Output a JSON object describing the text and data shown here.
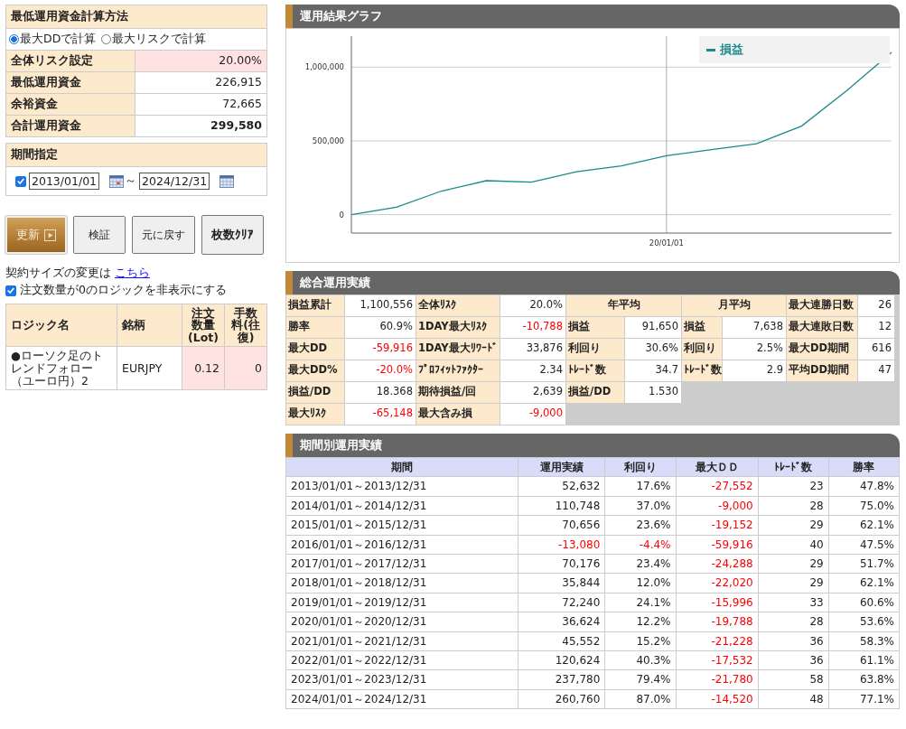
{
  "calc_method": {
    "title": "最低運用資金計算方法",
    "options": [
      {
        "label": "最大DDで計算",
        "selected": true
      },
      {
        "label": "最大リスクで計算",
        "selected": false
      }
    ]
  },
  "funds": [
    {
      "label": "全体リスク設定",
      "value": "20.00%",
      "kind": "input"
    },
    {
      "label": "最低運用資金",
      "value": "226,915",
      "kind": "plain"
    },
    {
      "label": "余裕資金",
      "value": "72,665",
      "kind": "plain"
    },
    {
      "label": "合計運用資金",
      "value": "299,580",
      "kind": "total"
    }
  ],
  "period": {
    "title": "期間指定",
    "enabled": true,
    "from": "2013/01/01",
    "separator": "～",
    "to": "2024/12/31"
  },
  "buttons": [
    {
      "label": "更新",
      "kind": "primary"
    },
    {
      "label": "検証",
      "kind": "normal"
    },
    {
      "label": "元に戻す",
      "kind": "normal"
    },
    {
      "label": "枚数ｸﾘｱ",
      "kind": "bold"
    }
  ],
  "contract_note": {
    "text": "契約サイズの変更は",
    "link": "こちら"
  },
  "hide_zero": {
    "label": "注文数量が0のロジックを非表示にする",
    "checked": true
  },
  "logic_table": {
    "columns": [
      "ロジック名",
      "銘柄",
      "注文数量(Lot)",
      "手数料(往復)"
    ],
    "rows": [
      {
        "name": "●ローソク足のトレンドフォロー（ユーロ円）2",
        "symbol": "EURJPY",
        "lots": "0.12",
        "fee": "0"
      }
    ]
  },
  "graph": {
    "title": "運用結果グラフ",
    "x_axis_label": "20/01/01",
    "chart_data": {
      "type": "line",
      "grid": true,
      "ylim": [
        -125000,
        1210000
      ],
      "yticks": [
        {
          "value": 0,
          "label": "0"
        },
        {
          "value": 500000,
          "label": "500,000"
        },
        {
          "value": 1000000,
          "label": "1,000,000"
        }
      ],
      "categories": [
        null,
        null,
        null,
        null,
        null,
        null,
        null,
        null,
        null,
        null,
        null,
        null,
        null
      ],
      "series": [
        {
          "name": "損益",
          "color": "#1a8a8a",
          "values": [
            0,
            50000,
            160000,
            230000,
            220000,
            290000,
            330000,
            400000,
            440000,
            480000,
            600000,
            840000,
            1100000
          ]
        }
      ]
    }
  },
  "summary": {
    "title": "総合運用実績",
    "groups": [
      {
        "cells": [
          {
            "label": "損益累計",
            "value": "1,100,556",
            "negative": false
          },
          {
            "label": "勝率",
            "value": "60.9%",
            "negative": false
          },
          {
            "label": "最大DD",
            "value": "-59,916",
            "negative": true
          },
          {
            "label": "最大DD%",
            "value": "-20.0%",
            "negative": true
          },
          {
            "label": "損益/DD",
            "value": "18.368",
            "negative": false
          },
          {
            "label": "最大ﾘｽｸ",
            "value": "-65,148",
            "negative": true
          }
        ]
      },
      {
        "cells": [
          {
            "label": "全体ﾘｽｸ",
            "value": "20.0%",
            "negative": false
          },
          {
            "label": "1DAY最大ﾘｽｸ",
            "value": "-10,788",
            "negative": true
          },
          {
            "label": "1DAY最大ﾘﾜｰﾄﾞ",
            "value": "33,876",
            "negative": false
          },
          {
            "label": "ﾌﾟﾛﾌｨｯﾄﾌｧｸﾀｰ",
            "value": "2.34",
            "negative": false
          },
          {
            "label": "期待損益/回",
            "value": "2,639",
            "negative": false
          },
          {
            "label": "最大含み損",
            "value": "-9,000",
            "negative": true
          }
        ]
      },
      {
        "header": "年平均",
        "cells": [
          {
            "label": "損益",
            "value": "91,650",
            "negative": false
          },
          {
            "label": "利回り",
            "value": "30.6%",
            "negative": false
          },
          {
            "label": "ﾄﾚｰﾄﾞ数",
            "value": "34.7",
            "negative": false
          },
          {
            "label": "損益/DD",
            "value": "1.530",
            "negative": false
          }
        ]
      },
      {
        "header": "月平均",
        "cells": [
          {
            "label": "損益",
            "value": "7,638",
            "negative": false
          },
          {
            "label": "利回り",
            "value": "2.5%",
            "negative": false
          },
          {
            "label": "ﾄﾚｰﾄﾞ数",
            "value": "2.9",
            "negative": false
          }
        ]
      },
      {
        "cells": [
          {
            "label": "最大連勝日数",
            "value": "26",
            "negative": false
          },
          {
            "label": "最大連敗日数",
            "value": "12",
            "negative": false
          },
          {
            "label": "最大DD期間",
            "value": "616",
            "negative": false
          },
          {
            "label": "平均DD期間",
            "value": "47",
            "negative": false
          }
        ]
      }
    ]
  },
  "periods": {
    "title": "期間別運用実績",
    "columns": [
      "期間",
      "運用実績",
      "利回り",
      "最大ＤＤ",
      "ﾄﾚｰﾄﾞ数",
      "勝率"
    ],
    "rows": [
      {
        "cells": [
          {
            "text": "2013/01/01～2013/12/31",
            "negative": false
          },
          {
            "text": "52,632",
            "negative": false
          },
          {
            "text": "17.6%",
            "negative": false
          },
          {
            "text": "-27,552",
            "negative": true
          },
          {
            "text": "23",
            "negative": false
          },
          {
            "text": "47.8%",
            "negative": false
          }
        ]
      },
      {
        "cells": [
          {
            "text": "2014/01/01～2014/12/31",
            "negative": false
          },
          {
            "text": "110,748",
            "negative": false
          },
          {
            "text": "37.0%",
            "negative": false
          },
          {
            "text": "-9,000",
            "negative": true
          },
          {
            "text": "28",
            "negative": false
          },
          {
            "text": "75.0%",
            "negative": false
          }
        ]
      },
      {
        "cells": [
          {
            "text": "2015/01/01～2015/12/31",
            "negative": false
          },
          {
            "text": "70,656",
            "negative": false
          },
          {
            "text": "23.6%",
            "negative": false
          },
          {
            "text": "-19,152",
            "negative": true
          },
          {
            "text": "29",
            "negative": false
          },
          {
            "text": "62.1%",
            "negative": false
          }
        ]
      },
      {
        "cells": [
          {
            "text": "2016/01/01～2016/12/31",
            "negative": false
          },
          {
            "text": "-13,080",
            "negative": true
          },
          {
            "text": "-4.4%",
            "negative": true
          },
          {
            "text": "-59,916",
            "negative": true
          },
          {
            "text": "40",
            "negative": false
          },
          {
            "text": "47.5%",
            "negative": false
          }
        ]
      },
      {
        "cells": [
          {
            "text": "2017/01/01～2017/12/31",
            "negative": false
          },
          {
            "text": "70,176",
            "negative": false
          },
          {
            "text": "23.4%",
            "negative": false
          },
          {
            "text": "-24,288",
            "negative": true
          },
          {
            "text": "29",
            "negative": false
          },
          {
            "text": "51.7%",
            "negative": false
          }
        ]
      },
      {
        "cells": [
          {
            "text": "2018/01/01～2018/12/31",
            "negative": false
          },
          {
            "text": "35,844",
            "negative": false
          },
          {
            "text": "12.0%",
            "negative": false
          },
          {
            "text": "-22,020",
            "negative": true
          },
          {
            "text": "29",
            "negative": false
          },
          {
            "text": "62.1%",
            "negative": false
          }
        ]
      },
      {
        "cells": [
          {
            "text": "2019/01/01～2019/12/31",
            "negative": false
          },
          {
            "text": "72,240",
            "negative": false
          },
          {
            "text": "24.1%",
            "negative": false
          },
          {
            "text": "-15,996",
            "negative": true
          },
          {
            "text": "33",
            "negative": false
          },
          {
            "text": "60.6%",
            "negative": false
          }
        ]
      },
      {
        "cells": [
          {
            "text": "2020/01/01～2020/12/31",
            "negative": false
          },
          {
            "text": "36,624",
            "negative": false
          },
          {
            "text": "12.2%",
            "negative": false
          },
          {
            "text": "-19,788",
            "negative": true
          },
          {
            "text": "28",
            "negative": false
          },
          {
            "text": "53.6%",
            "negative": false
          }
        ]
      },
      {
        "cells": [
          {
            "text": "2021/01/01～2021/12/31",
            "negative": false
          },
          {
            "text": "45,552",
            "negative": false
          },
          {
            "text": "15.2%",
            "negative": false
          },
          {
            "text": "-21,228",
            "negative": true
          },
          {
            "text": "36",
            "negative": false
          },
          {
            "text": "58.3%",
            "negative": false
          }
        ]
      },
      {
        "cells": [
          {
            "text": "2022/01/01～2022/12/31",
            "negative": false
          },
          {
            "text": "120,624",
            "negative": false
          },
          {
            "text": "40.3%",
            "negative": false
          },
          {
            "text": "-17,532",
            "negative": true
          },
          {
            "text": "36",
            "negative": false
          },
          {
            "text": "61.1%",
            "negative": false
          }
        ]
      },
      {
        "cells": [
          {
            "text": "2023/01/01～2023/12/31",
            "negative": false
          },
          {
            "text": "237,780",
            "negative": false
          },
          {
            "text": "79.4%",
            "negative": false
          },
          {
            "text": "-21,780",
            "negative": true
          },
          {
            "text": "58",
            "negative": false
          },
          {
            "text": "63.8%",
            "negative": false
          }
        ]
      },
      {
        "cells": [
          {
            "text": "2024/01/01～2024/12/31",
            "negative": false
          },
          {
            "text": "260,760",
            "negative": false
          },
          {
            "text": "87.0%",
            "negative": false
          },
          {
            "text": "-14,520",
            "negative": true
          },
          {
            "text": "48",
            "negative": false
          },
          {
            "text": "77.1%",
            "negative": false
          }
        ]
      }
    ]
  }
}
